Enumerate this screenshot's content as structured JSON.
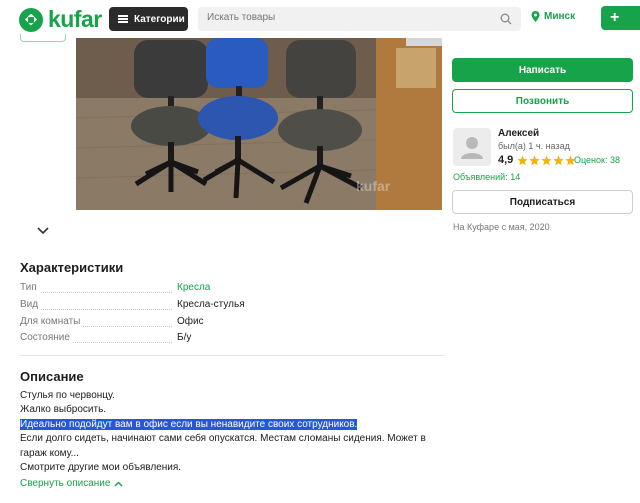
{
  "header": {
    "logo_text": "kufar",
    "categories_label": "Категории",
    "search_placeholder": "Искать товары",
    "location": "Минск",
    "add_label": "+"
  },
  "photo": {
    "watermark": "kufar"
  },
  "characteristics": {
    "title": "Характеристики",
    "rows": [
      {
        "label": "Тип",
        "value": "Кресла"
      },
      {
        "label": "Вид",
        "value": "Кресла-стулья"
      },
      {
        "label": "Для комнаты",
        "value": "Офис"
      },
      {
        "label": "Состояние",
        "value": "Б/у"
      }
    ]
  },
  "description": {
    "title": "Описание",
    "lines": [
      "Стулья по червонцу.",
      "Жалко выбросить.",
      "Идеально подойдут вам в офис если вы ненавидите своих сотрудников.",
      "Если долго сидеть, начинают сами себя опускатся. Местам сломаны сидения. Может в гараж кому...",
      "Смотрите другие мои объявления."
    ],
    "collapse_label": "Свернуть описание"
  },
  "seller": {
    "write_label": "Написать",
    "call_label": "Позвонить",
    "name": "Алексей",
    "last_seen": "был(а) 1 ч. назад",
    "rating": "4,9",
    "stars": 5,
    "reviews": "Оценок: 38",
    "ads": "Объявлений: 14",
    "subscribe_label": "Подписаться",
    "since": "На Куфаре с мая, 2020"
  },
  "colors": {
    "brand": "#16a34a",
    "star": "#f5b400",
    "highlight": "#1f5bd6"
  }
}
